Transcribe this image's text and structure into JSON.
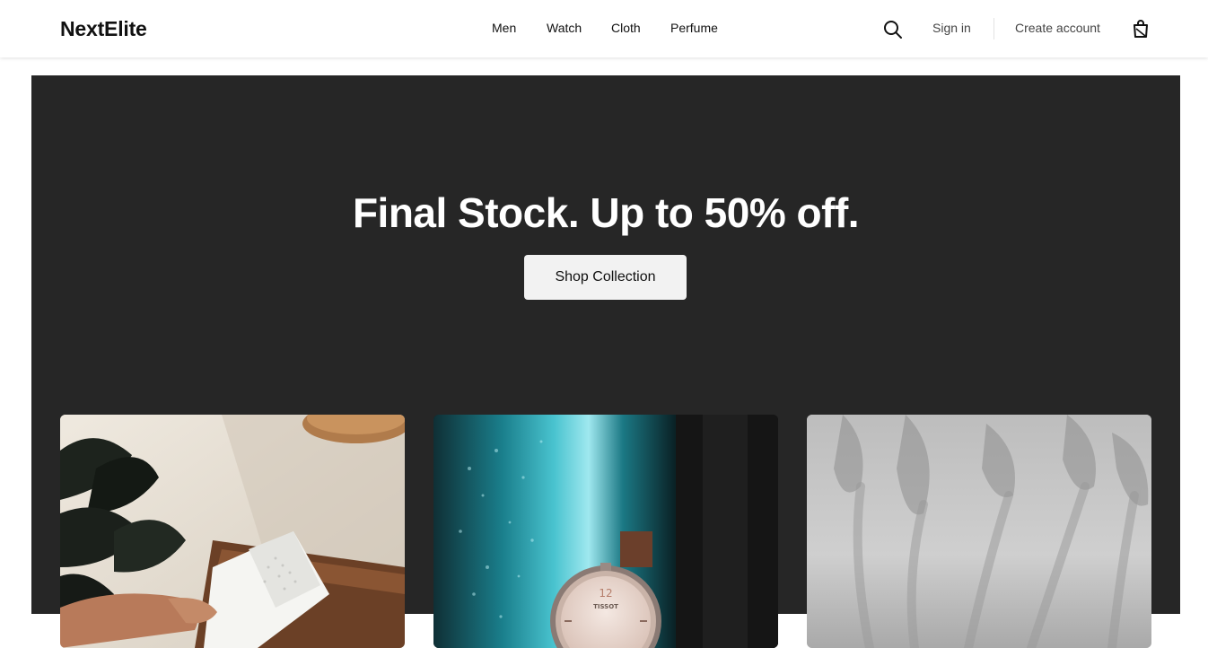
{
  "header": {
    "logo": "NextElite",
    "nav": [
      "Men",
      "Watch",
      "Cloth",
      "Perfume"
    ],
    "search_icon": "search-icon",
    "sign_in": "Sign in",
    "create_account": "Create account",
    "bag_icon": "shopping-bag-icon"
  },
  "hero": {
    "title": "Final Stock. Up to 50% off.",
    "button": "Shop Collection",
    "background": "#262626"
  },
  "cards": [
    {
      "name": "cloth-card-image"
    },
    {
      "name": "watch-card-image",
      "dial_text": "TISSOT",
      "dial_numeral": "12"
    },
    {
      "name": "perfume-card-image"
    }
  ]
}
